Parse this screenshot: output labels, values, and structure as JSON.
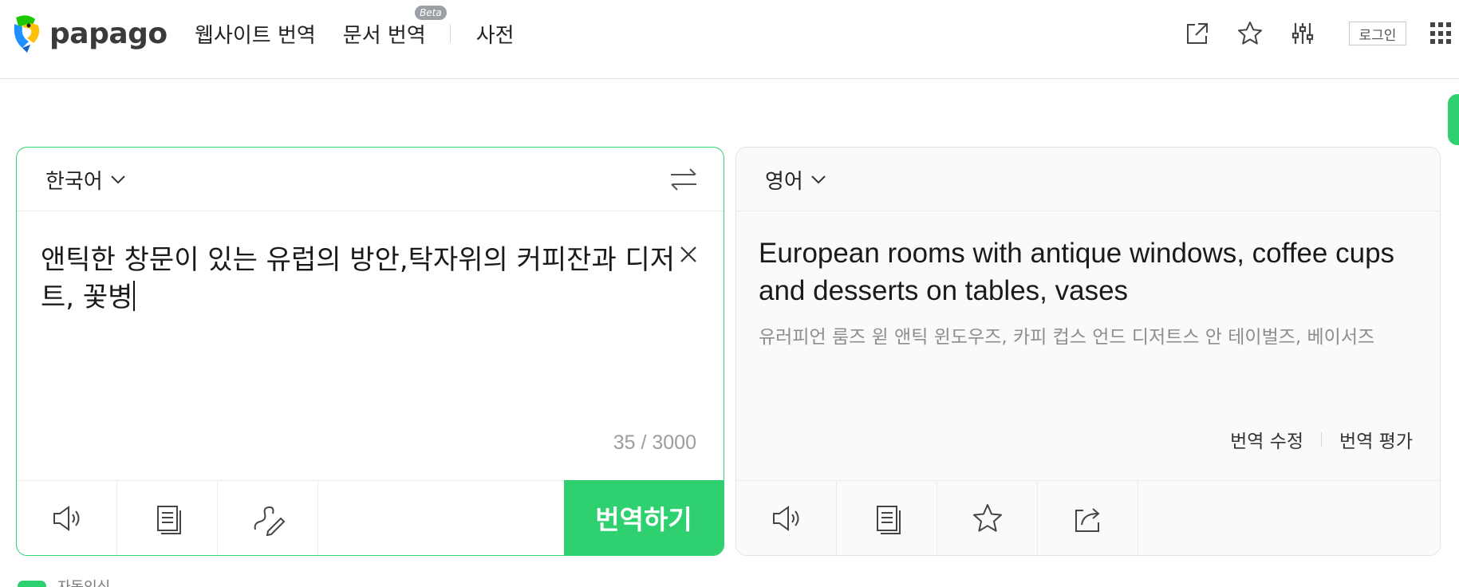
{
  "brand": {
    "name": "papago",
    "accent": "#2ed06f"
  },
  "nav": {
    "website_translate": "웹사이트 번역",
    "document_translate": "문서 번역",
    "beta_badge": "Beta",
    "dictionary": "사전"
  },
  "header": {
    "login_label": "로그인",
    "icons": [
      "open-new-window-icon",
      "star-icon",
      "settings-sliders-icon",
      "apps-grid-icon"
    ]
  },
  "source": {
    "language": "한국어",
    "text": "앤틱한 창문이 있는 유럽의 방안,탁자위의 커피잔과 디저트, 꽃병",
    "char_count": "35 / 3000",
    "translate_button": "번역하기"
  },
  "target": {
    "language": "영어",
    "text": "European rooms with antique windows, coffee cups and desserts on tables, vases",
    "pronunciation": "유러피언 룸즈 윋 앤틱 윈도우즈, 카피 컵스 언드 디저트스 안 테이벌즈, 베이서즈",
    "edit_translation": "번역 수정",
    "rate_translation": "번역 평가"
  },
  "footer": {
    "auto_detect_label": "자동인식"
  }
}
